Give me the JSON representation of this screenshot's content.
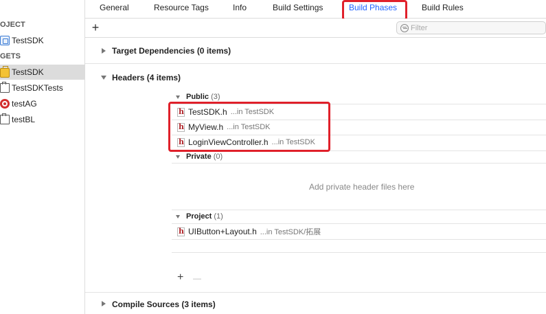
{
  "sidebar": {
    "project_header": "OJECT",
    "targets_header": "GETS",
    "project_item": "TestSDK",
    "targets": [
      {
        "label": "TestSDK",
        "icon": "framework-icon",
        "selected": true
      },
      {
        "label": "TestSDKTests",
        "icon": "test-bundle-icon",
        "selected": false
      },
      {
        "label": "testAG",
        "icon": "target-icon",
        "selected": false
      },
      {
        "label": "testBL",
        "icon": "bundle-icon",
        "selected": false
      }
    ]
  },
  "tabs": [
    {
      "label": "General"
    },
    {
      "label": "Resource Tags"
    },
    {
      "label": "Info"
    },
    {
      "label": "Build Settings"
    },
    {
      "label": "Build Phases",
      "active": true
    },
    {
      "label": "Build Rules"
    }
  ],
  "toolbar": {
    "add_label": "+",
    "filter_placeholder": "Filter"
  },
  "phases": {
    "target_dependencies": "Target Dependencies (0 items)",
    "headers": "Headers (4 items)",
    "compile_sources": "Compile Sources (3 items)"
  },
  "headers": {
    "public": {
      "label": "Public",
      "count": "(3)"
    },
    "private": {
      "label": "Private",
      "count": "(0)"
    },
    "project": {
      "label": "Project",
      "count": "(1)"
    },
    "public_files": [
      {
        "name": "TestSDK.h",
        "path": "...in TestSDK"
      },
      {
        "name": "MyView.h",
        "path": "...in TestSDK"
      },
      {
        "name": "LoginViewController.h",
        "path": "...in TestSDK"
      }
    ],
    "private_placeholder": "Add private header files here",
    "project_files": [
      {
        "name": "UIButton+Layout.h",
        "path": "...in TestSDK/拓展"
      }
    ],
    "add_label": "+",
    "remove_label": "—"
  },
  "colors": {
    "accent": "#1f62ff",
    "highlight": "#e0202a",
    "selection": "#dcdcdc"
  }
}
